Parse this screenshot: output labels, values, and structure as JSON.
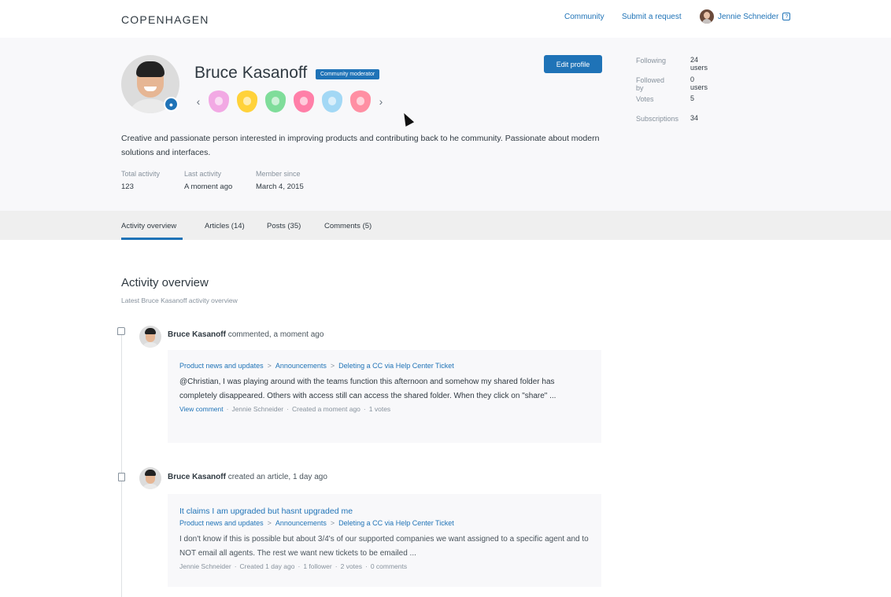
{
  "header": {
    "logo": "COPENHAGEN",
    "nav": [
      "Community",
      "Submit a request"
    ],
    "user_name": "Jennie Schneider",
    "user_menu_icon": "?"
  },
  "profile": {
    "name": "Bruce Kasanoff",
    "role_badge": "Community moderator",
    "edit_label": "Edit profile",
    "bio": "Creative and passionate person interested in improving products and contributing back to he community. Passionate about modern solutions and interfaces.",
    "achievement_colors": [
      "#f2a9e4",
      "#ffd23a",
      "#7fdd9a",
      "#ff7fa8",
      "#a3d8f5",
      "#ff8fa3"
    ],
    "meta": [
      {
        "label": "Total activity",
        "value": "123"
      },
      {
        "label": "Last activity",
        "value": "A moment ago"
      },
      {
        "label": "Member since",
        "value": "March 4, 2015"
      }
    ],
    "stats": [
      {
        "label": "Following",
        "value": "24 users"
      },
      {
        "label": "Followed by",
        "value": "0 users"
      },
      {
        "label": "Votes",
        "value": "5"
      },
      {
        "label": "Subscriptions",
        "value": "34"
      }
    ]
  },
  "tabs": [
    "Activity overview",
    "Articles (14)",
    "Posts (35)",
    "Comments (5)"
  ],
  "activity": {
    "title": "Activity overview",
    "subtitle": "Latest Bruce Kasanoff activity overview",
    "items": [
      {
        "author": "Bruce Kasanoff",
        "action": "commented, a moment ago",
        "crumbs": [
          "Product news and updates",
          "Announcements",
          "Deleting a CC via Help Center Ticket"
        ],
        "body": "@Christian, I was playing around with the teams function this afternoon and somehow my shared folder has completely disappeared.  Others with access still can access the shared folder.  When they click on \"share\" ...",
        "meta_link": "View comment",
        "meta": [
          "Jennie Schneider",
          "Created a moment ago",
          "1 votes"
        ]
      },
      {
        "author": "Bruce Kasanoff",
        "action": "created an article, 1 day ago",
        "title": "It claims I am upgraded but hasnt upgraded me",
        "crumbs": [
          "Product news and updates",
          "Announcements",
          "Deleting a CC via Help Center Ticket"
        ],
        "body": "I don't know if this is possible but about 3/4's of our supported companies we want assigned to a specific agent and to NOT email all agents.   The rest we want new tickets to be emailed ...",
        "meta": [
          "Jennie Schneider",
          "Created 1 day ago",
          "1 follower",
          "2 votes",
          "0 comments"
        ]
      }
    ]
  }
}
